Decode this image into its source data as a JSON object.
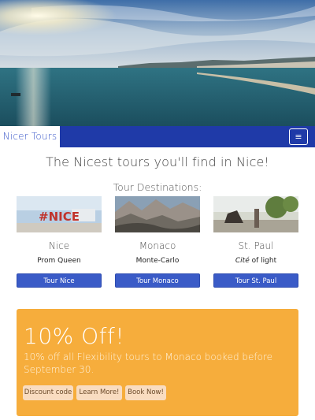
{
  "navbar": {
    "brand": "Nicer Tours",
    "menu_icon": "hamburger-menu-icon",
    "menu_glyph": "≡",
    "bar_color": "#1f3aa8"
  },
  "main": {
    "headline": "The Nicest tours you'll find in Nice!",
    "section_title": "Tour Destinations:"
  },
  "cards": [
    {
      "name": "Nice",
      "description": "Prom Queen",
      "button": "Tour Nice",
      "thumb_text": "#NICE"
    },
    {
      "name": "Monaco",
      "description": "Monte-Carlo",
      "button": "Tour Monaco"
    },
    {
      "name": "St. Paul",
      "description_italic": "Cité",
      "description_rest": " of light",
      "button": "Tour St. Paul"
    }
  ],
  "promo": {
    "title": "10% Off!",
    "text": "10% off all Flexibility tours to Monaco booked before September 30.",
    "buttons": [
      "Discount code",
      "Learn More!",
      "Book Now!"
    ],
    "color": "#f6ad3c"
  },
  "colors": {
    "primary_button": "#3a5bc7",
    "accent": "#f6ad3c"
  }
}
